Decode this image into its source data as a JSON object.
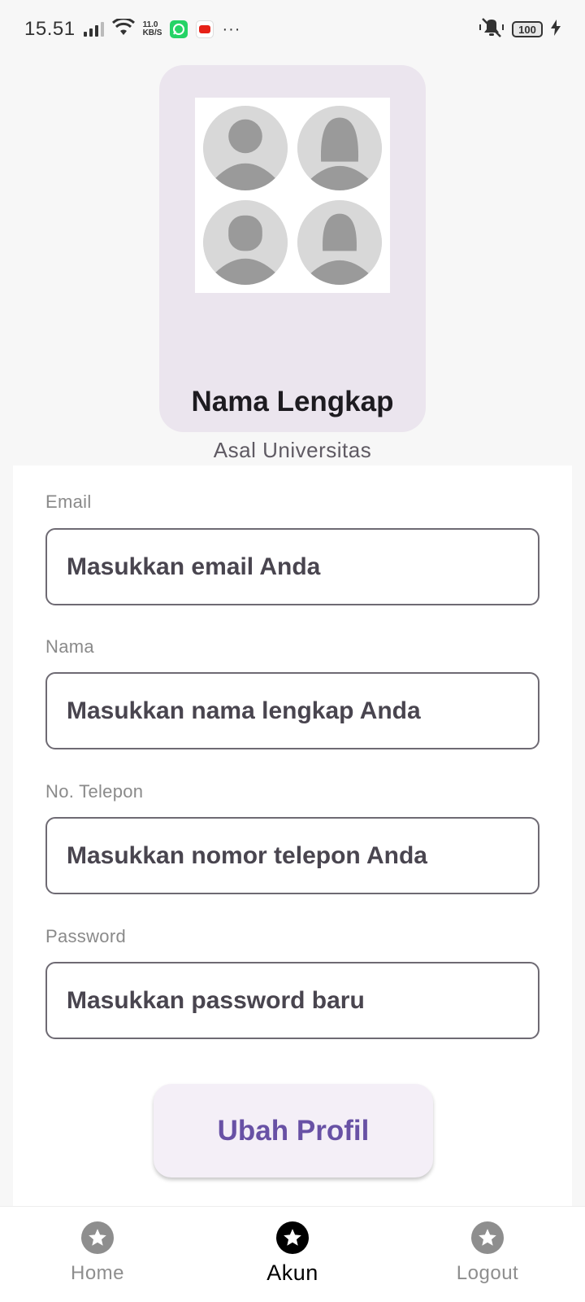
{
  "status_bar": {
    "time": "15.51",
    "net_speed_value": "11.0",
    "net_speed_unit": "KB/S",
    "overflow_dots": "···",
    "battery_level": "100"
  },
  "profile": {
    "name": "Nama Lengkap",
    "university": "Asal Universitas"
  },
  "form": {
    "fields": [
      {
        "label": "Email",
        "placeholder": "Masukkan email Anda"
      },
      {
        "label": "Nama",
        "placeholder": "Masukkan nama lengkap Anda"
      },
      {
        "label": "No. Telepon",
        "placeholder": "Masukkan nomor telepon Anda"
      },
      {
        "label": "Password",
        "placeholder": "Masukkan password baru"
      }
    ],
    "submit_label": "Ubah Profil"
  },
  "bottom_nav": {
    "items": [
      {
        "label": "Home",
        "icon": "star-icon",
        "active": false
      },
      {
        "label": "Akun",
        "icon": "star-icon",
        "active": true
      },
      {
        "label": "Logout",
        "icon": "star-icon",
        "active": false
      }
    ]
  },
  "colors": {
    "accent": "#6851a5",
    "card_bg": "#ebe5ee",
    "button_bg": "#f4eff7"
  }
}
